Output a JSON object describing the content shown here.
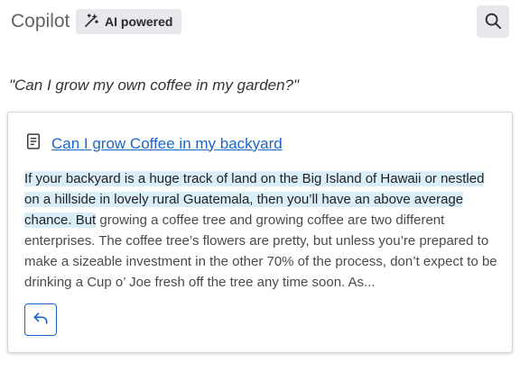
{
  "header": {
    "title": "Copilot",
    "badge_label": "AI powered",
    "badge_icon": "magic-wand-icon",
    "search_icon": "search-icon"
  },
  "query": {
    "text": "\"Can I grow my own coffee in my garden?\""
  },
  "result": {
    "icon": "document-icon",
    "link_text": "Can I grow Coffee in my backyard",
    "snippet_highlighted": "If your backyard is a huge track of land on the Big Island of Hawaii or nestled on a hillside in lovely rural Guatemala, then you’ll have an above average chance. But",
    "snippet_rest": " growing a coffee tree and growing coffee are two different enterprises. The coffee tree’s flowers are pretty, but unless you’re prepared to make a sizeable investment in the other 70% of the process, don’t expect to be drinking a Cup o’ Joe fresh off the tree any time soon. As...",
    "reply_icon": "reply-icon"
  },
  "colors": {
    "accent": "#1a66c9",
    "highlight": "#d9eef8",
    "chip_bg": "#e6e8eb"
  }
}
